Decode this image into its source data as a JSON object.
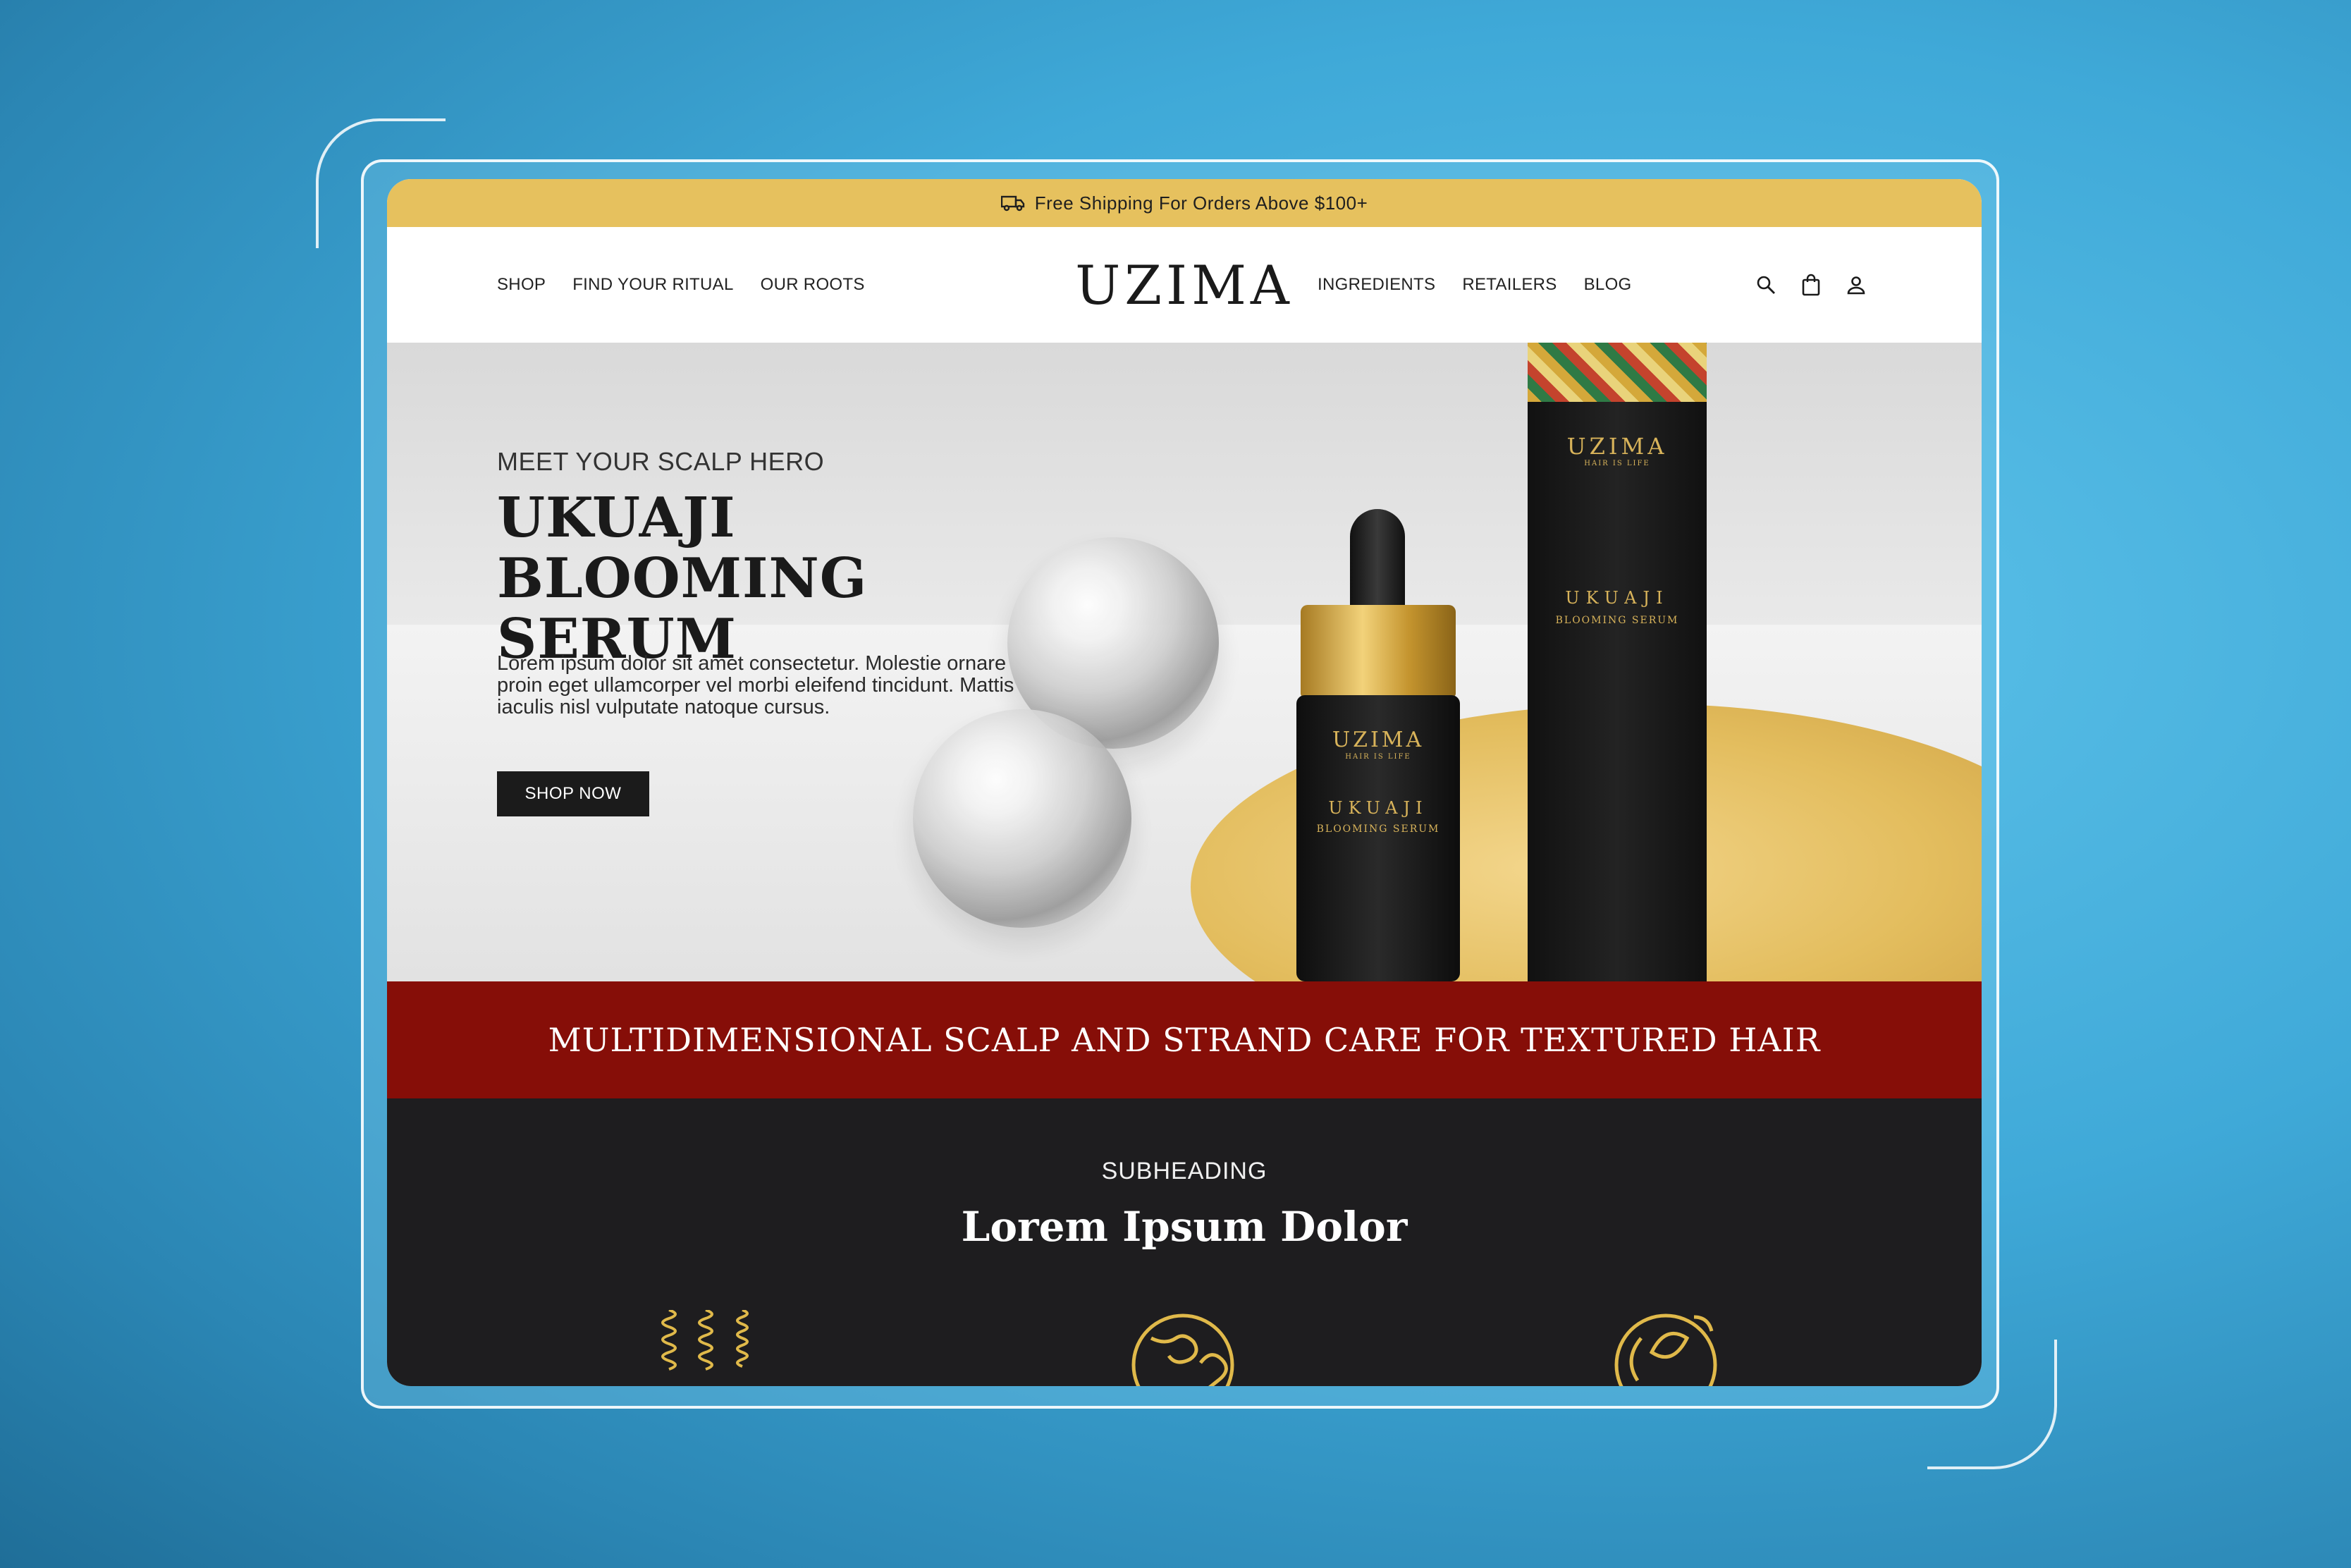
{
  "announcement": {
    "text": "Free Shipping For Orders Above $100+",
    "icon": "truck-icon"
  },
  "header": {
    "logo": "UZIMA",
    "nav_left": [
      "SHOP",
      "FIND YOUR RITUAL",
      "OUR ROOTS"
    ],
    "nav_right": [
      "INGREDIENTS",
      "RETAILERS",
      "BLOG"
    ],
    "icons": [
      "search-icon",
      "bag-icon",
      "account-icon"
    ]
  },
  "hero": {
    "eyebrow": "MEET YOUR SCALP HERO",
    "title": "UKUAJI BLOOMING SERUM",
    "body": "Lorem ipsum dolor sit amet consectetur. Molestie ornare proin eget ullamcorper vel morbi eleifend tincidunt. Mattis iaculis nisl vulputate natoque cursus.",
    "cta": "SHOP NOW",
    "product": {
      "brand": "UZIMA",
      "tagline": "HAIR IS LIFE",
      "name": "UKUAJI",
      "type": "BLOOMING SERUM"
    }
  },
  "banner": {
    "text": "MULTIDIMENSIONAL SCALP AND STRAND CARE FOR TEXTURED HAIR"
  },
  "section": {
    "subheading": "SUBHEADING",
    "title": "Lorem Ipsum Dolor",
    "icons": [
      "curls-icon",
      "globe-heart-icon",
      "leaf-cycle-icon"
    ]
  },
  "colors": {
    "announcement_bg": "#e6c15e",
    "banner_bg": "#860e08",
    "dark_bg": "#1e1d1f",
    "accent_gold": "#d8b35a"
  }
}
